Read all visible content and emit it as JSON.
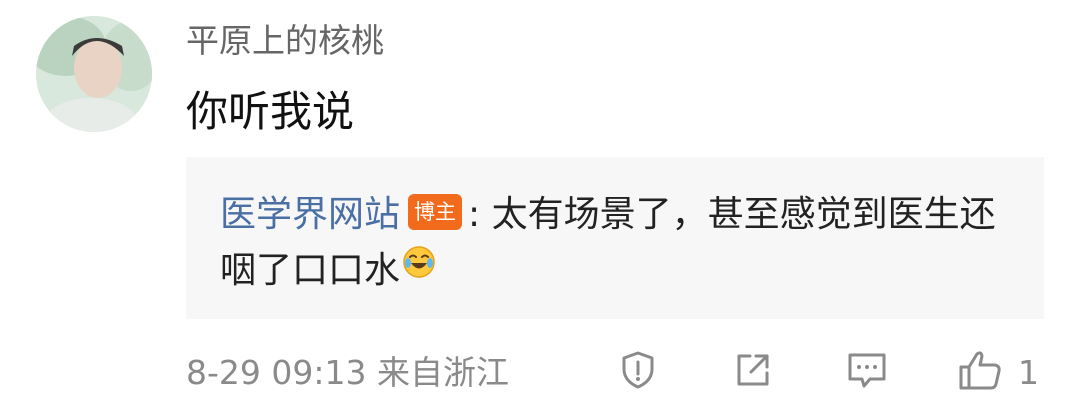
{
  "comment": {
    "username": "平原上的核桃",
    "text": "你听我说",
    "timestamp": "8-29 09:13",
    "location": "来自浙江",
    "like_count": "1"
  },
  "reply": {
    "author": "医学界网站",
    "badge": "博主",
    "separator": ":",
    "text": "太有场景了，甚至感觉到医生还咽了口口水",
    "emoji": "laughing-crying-emoji"
  },
  "actions": {
    "report_icon": "shield-exclamation-icon",
    "share_icon": "share-arrow-icon",
    "reply_icon": "comment-bubble-icon",
    "like_icon": "thumbs-up-icon"
  },
  "colors": {
    "author_link": "#4a6fa5",
    "badge_bg": "#f26a1b",
    "meta_text": "#8a8a8a",
    "reply_bg": "#f7f7f7"
  }
}
